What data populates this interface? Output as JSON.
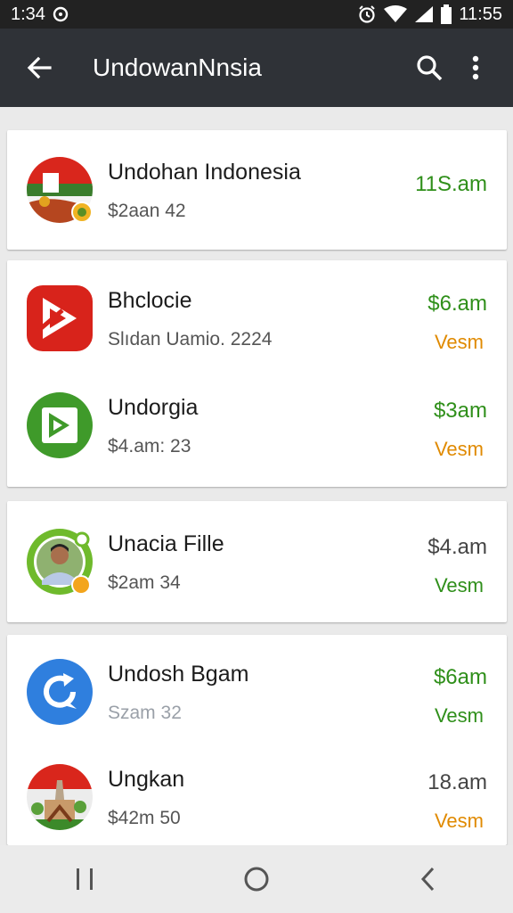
{
  "status_bar": {
    "time_left": "1:34",
    "time_right": "11:55",
    "icons": [
      "sync-icon",
      "alarm-icon",
      "wifi-icon",
      "signal-icon",
      "battery-icon"
    ]
  },
  "app_bar": {
    "title": "UndowanNnsia",
    "icons": [
      "back-arrow-icon",
      "search-icon",
      "more-vert-icon"
    ]
  },
  "colors": {
    "app_bar_bg": "#2f3237",
    "status_bar_bg": "#222222",
    "green": "#2f8f1a",
    "orange": "#e08a00",
    "background": "#eaeaea"
  },
  "items": [
    {
      "name": "Undohan Indonesia",
      "sub": "$2aan 42",
      "time": "11S.am",
      "status": "",
      "avatar": "indonesia-flag-avatar"
    },
    {
      "name": "Bhclocie",
      "sub": "Slıdan Uamio. 2224",
      "time": "$6.am",
      "status": "Vesm",
      "avatar": "red-play-logo-avatar"
    },
    {
      "name": "Undorgia",
      "sub": "$4.am: 23",
      "time": "$3am",
      "status": "Vesm",
      "avatar": "green-play-logo-avatar"
    },
    {
      "name": "Unacia Fille",
      "sub": "$2am 34",
      "time": "$4.am",
      "status": "Vesm",
      "avatar": "person-photo-avatar"
    },
    {
      "name": "Undosh Bgam",
      "sub": "Szam 32",
      "time": "$6am",
      "status": "Vesm",
      "avatar": "blue-refresh-logo-avatar"
    },
    {
      "name": "Ungkan",
      "sub": "$42m 50",
      "time": "18.am",
      "status": "Vesm",
      "avatar": "monument-scene-avatar"
    }
  ],
  "nav_bar": {
    "icons": [
      "recents-icon",
      "home-icon",
      "back-icon"
    ]
  }
}
